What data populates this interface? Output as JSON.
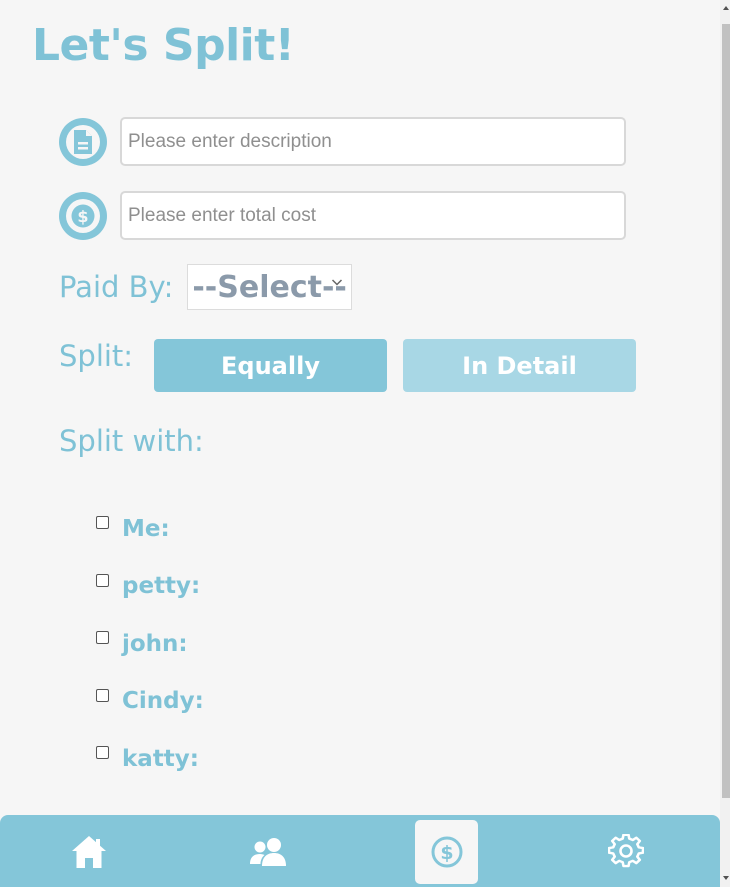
{
  "page": {
    "title": "Let's Split!"
  },
  "form": {
    "description": {
      "value": "",
      "placeholder": "Please enter description",
      "icon": "document-icon"
    },
    "cost": {
      "value": "",
      "placeholder": "Please enter total cost",
      "icon": "dollar-icon"
    },
    "paid_by": {
      "label": "Paid By:",
      "selected": "--Select--"
    },
    "split": {
      "label": "Split:",
      "equally_label": "Equally",
      "detail_label": "In Detail",
      "active": "Equally"
    },
    "split_with": {
      "label": "Split with:"
    }
  },
  "members": [
    {
      "name": "Me:",
      "checked": false
    },
    {
      "name": "petty:",
      "checked": false
    },
    {
      "name": "john:",
      "checked": false
    },
    {
      "name": "Cindy:",
      "checked": false
    },
    {
      "name": "katty:",
      "checked": false
    }
  ],
  "nav": [
    {
      "icon": "home-icon",
      "active": false
    },
    {
      "icon": "friends-icon",
      "active": false
    },
    {
      "icon": "dollar-icon",
      "active": true
    },
    {
      "icon": "gear-icon",
      "active": false
    }
  ],
  "colors": {
    "accent": "#84c6d9",
    "text_accent": "#7fc2d6",
    "detail_button": "#a8d7e5",
    "background": "#f6f6f6"
  }
}
